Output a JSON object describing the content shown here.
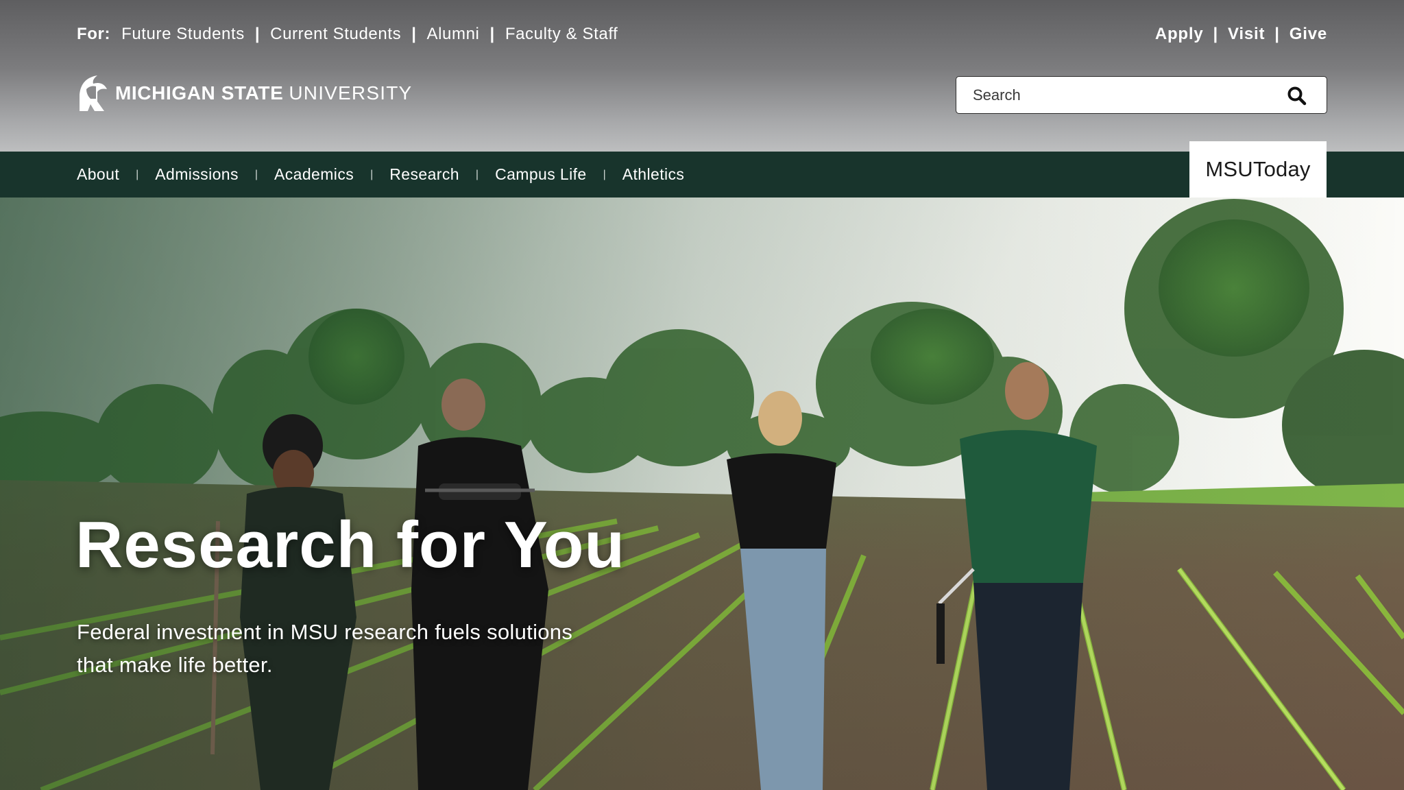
{
  "audience": {
    "label": "For:",
    "links": [
      "Future Students",
      "Current Students",
      "Alumni",
      "Faculty & Staff"
    ]
  },
  "utility": {
    "links": [
      "Apply",
      "Visit",
      "Give"
    ]
  },
  "brand": {
    "bold": "MICHIGAN STATE",
    "light": "UNIVERSITY"
  },
  "search": {
    "placeholder": "Search",
    "icon": "search-icon"
  },
  "nav": {
    "items": [
      "About",
      "Admissions",
      "Academics",
      "Research",
      "Campus Life",
      "Athletics"
    ],
    "featured": "MSUToday"
  },
  "hero": {
    "title": "Research for You",
    "subtitle_line1": "Federal investment in MSU research fuels solutions",
    "subtitle_line2": "that make life better."
  },
  "colors": {
    "brand_green": "#18453b",
    "nav_bg": "#18342c",
    "header_grey": "#7c7c7e"
  }
}
